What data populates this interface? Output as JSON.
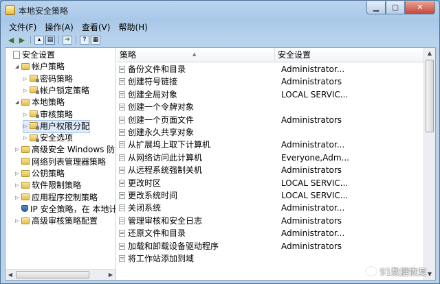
{
  "window": {
    "title": "本地安全策略"
  },
  "menu": [
    "文件(F)",
    "操作(A)",
    "查看(V)",
    "帮助(H)"
  ],
  "toolbar_icons": [
    "back-icon",
    "forward-icon",
    "up-folder-icon",
    "show-hide-tree-icon",
    "export-icon",
    "help-icon",
    "properties-icon"
  ],
  "tree": [
    {
      "label": "安全设置",
      "level": 0,
      "icon": "doc",
      "twisty": ""
    },
    {
      "label": "帐户策略",
      "level": 1,
      "icon": "folder",
      "twisty": "◢"
    },
    {
      "label": "密码策略",
      "level": 2,
      "icon": "folder",
      "twisty": "▷"
    },
    {
      "label": "帐户锁定策略",
      "level": 2,
      "icon": "folder",
      "twisty": "▷"
    },
    {
      "label": "本地策略",
      "level": 1,
      "icon": "folder",
      "twisty": "◢"
    },
    {
      "label": "审核策略",
      "level": 2,
      "icon": "folder",
      "twisty": "▷"
    },
    {
      "label": "用户权限分配",
      "level": 2,
      "icon": "folder",
      "twisty": "▷",
      "selected": true
    },
    {
      "label": "安全选项",
      "level": 2,
      "icon": "folder",
      "twisty": "▷"
    },
    {
      "label": "高级安全 Windows 防火墙",
      "level": 1,
      "icon": "folder",
      "twisty": "▷"
    },
    {
      "label": "网络列表管理器策略",
      "level": 1,
      "icon": "folder",
      "twisty": ""
    },
    {
      "label": "公钥策略",
      "level": 1,
      "icon": "folder",
      "twisty": "▷"
    },
    {
      "label": "软件限制策略",
      "level": 1,
      "icon": "folder",
      "twisty": "▷"
    },
    {
      "label": "应用程序控制策略",
      "level": 1,
      "icon": "folder",
      "twisty": "▷"
    },
    {
      "label": "IP 安全策略，在 本地计算机",
      "level": 1,
      "icon": "shield",
      "twisty": ""
    },
    {
      "label": "高级审核策略配置",
      "level": 1,
      "icon": "folder",
      "twisty": "▷"
    }
  ],
  "list": {
    "columns": [
      "策略",
      "安全设置"
    ],
    "rows": [
      {
        "policy": "备份文件和目录",
        "setting": "Administrator..."
      },
      {
        "policy": "创建符号链接",
        "setting": "Administrators"
      },
      {
        "policy": "创建全局对象",
        "setting": "LOCAL SERVIC..."
      },
      {
        "policy": "创建一个令牌对象",
        "setting": ""
      },
      {
        "policy": "创建一个页面文件",
        "setting": "Administrators"
      },
      {
        "policy": "创建永久共享对象",
        "setting": ""
      },
      {
        "policy": "从扩展坞上取下计算机",
        "setting": "Administrator..."
      },
      {
        "policy": "从网络访问此计算机",
        "setting": "Everyone,Adm..."
      },
      {
        "policy": "从远程系统强制关机",
        "setting": "Administrators"
      },
      {
        "policy": "更改时区",
        "setting": "LOCAL SERVIC..."
      },
      {
        "policy": "更改系统时间",
        "setting": "LOCAL SERVIC..."
      },
      {
        "policy": "关闭系统",
        "setting": "Administrator..."
      },
      {
        "policy": "管理审核和安全日志",
        "setting": "Administrators"
      },
      {
        "policy": "还原文件和目录",
        "setting": "Administrator..."
      },
      {
        "policy": "加载和卸载设备驱动程序",
        "setting": "Administrators"
      },
      {
        "policy": "将工作站添加到域",
        "setting": ""
      }
    ]
  },
  "watermark": "91数据恢复"
}
